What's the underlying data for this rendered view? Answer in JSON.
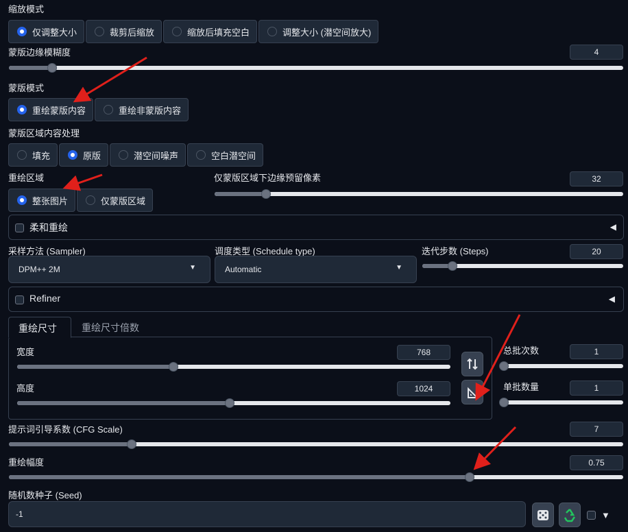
{
  "resize_mode": {
    "label": "缩放模式",
    "options": [
      "仅调整大小",
      "裁剪后缩放",
      "缩放后填充空白",
      "调整大小 (潜空间放大)"
    ],
    "selected": 0
  },
  "mask_blur": {
    "label": "蒙版边缘模糊度",
    "value": "4",
    "slider_fraction": 0.07
  },
  "mask_mode": {
    "label": "蒙版模式",
    "options": [
      "重绘蒙版内容",
      "重绘非蒙版内容"
    ],
    "selected": 0
  },
  "masked_content": {
    "label": "蒙版区域内容处理",
    "options": [
      "填充",
      "原版",
      "潜空间噪声",
      "空白潜空间"
    ],
    "selected": 1
  },
  "inpaint_area": {
    "label": "重绘区域",
    "options": [
      "整张图片",
      "仅蒙版区域"
    ],
    "selected": 0
  },
  "only_masked_padding": {
    "label": "仅蒙版区域下边缘预留像素",
    "value": "32",
    "slider_fraction": 0.125
  },
  "soft_inpainting": {
    "label": "柔和重绘"
  },
  "sampler": {
    "label": "采样方法 (Sampler)",
    "value": "DPM++ 2M"
  },
  "schedule_type": {
    "label": "调度类型 (Schedule type)",
    "value": "Automatic"
  },
  "steps": {
    "label": "迭代步数 (Steps)",
    "value": "20",
    "slider_fraction": 0.15
  },
  "refiner": {
    "label": "Refiner"
  },
  "size_tabs": [
    "重绘尺寸",
    "重绘尺寸倍数"
  ],
  "width": {
    "label": "宽度",
    "value": "768",
    "slider_fraction": 0.36
  },
  "height": {
    "label": "高度",
    "value": "1024",
    "slider_fraction": 0.49
  },
  "batch_count": {
    "label": "总批次数",
    "value": "1",
    "slider_fraction": 0.0
  },
  "batch_size": {
    "label": "单批数量",
    "value": "1",
    "slider_fraction": 0.0
  },
  "cfg_scale": {
    "label": "提示词引导系数 (CFG Scale)",
    "value": "7",
    "slider_fraction": 0.2
  },
  "denoising": {
    "label": "重绘幅度",
    "value": "0.75",
    "slider_fraction": 0.75
  },
  "seed": {
    "label": "随机数种子 (Seed)",
    "value": "-1"
  },
  "icons": {
    "swap": "swap-dimensions-icon",
    "ratio": "aspect-ratio-icon",
    "dice": "dice-icon",
    "recycle": "recycle-icon"
  },
  "colors": {
    "accent": "#2563eb",
    "annotation_arrow": "#e0201b",
    "background": "#0b0f19"
  }
}
